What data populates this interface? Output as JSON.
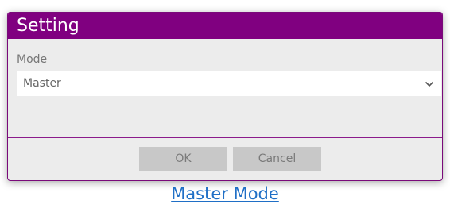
{
  "dialog": {
    "title": "Setting",
    "mode_label": "Mode",
    "mode_value": "Master",
    "ok_label": "OK",
    "cancel_label": "Cancel"
  },
  "caption": {
    "text": "Master Mode"
  },
  "colors": {
    "titlebar": "#800080",
    "link": "#1f6fc6"
  }
}
